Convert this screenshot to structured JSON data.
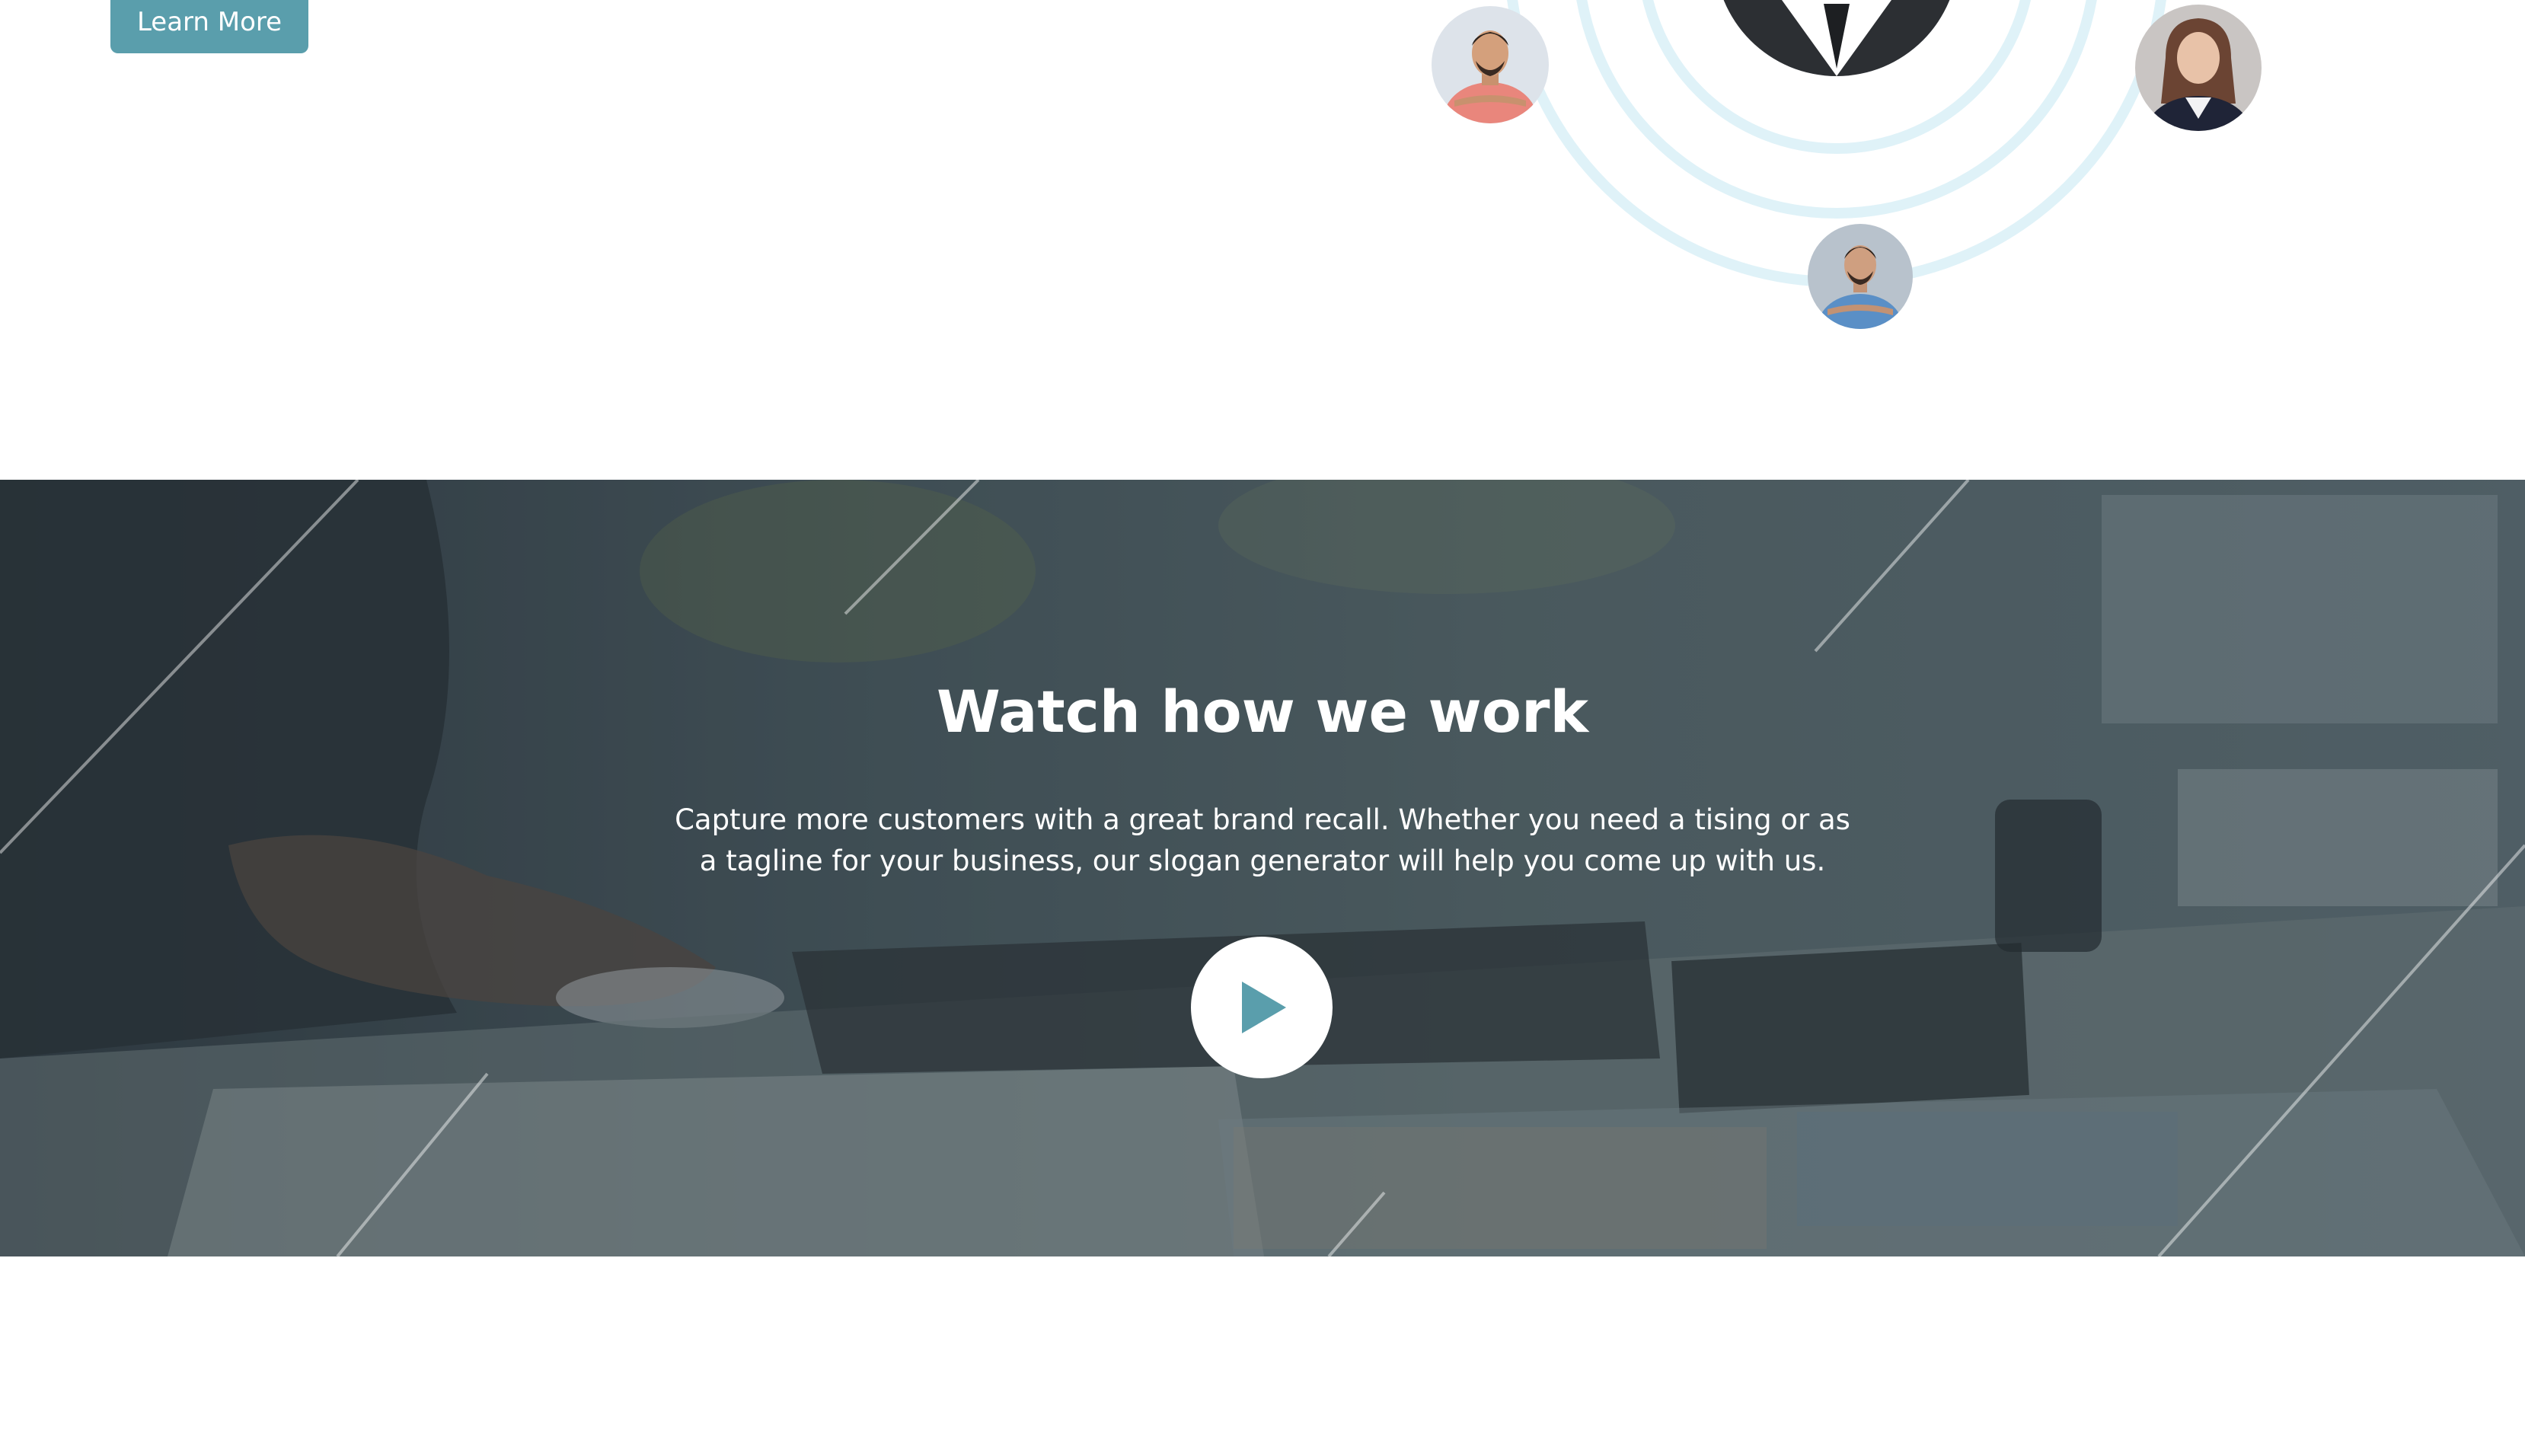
{
  "hero": {
    "cta_label": "Learn More",
    "accent_color": "#5a9eac",
    "ring_color": "#dff2f8",
    "avatars": [
      "avatar-man-pink-shirt",
      "avatar-woman-suit",
      "avatar-man-blue-shirt",
      "avatar-man-dark-suit"
    ]
  },
  "video": {
    "title": "Watch how we work",
    "description": "Capture more customers with a great brand recall. Whether you need a tising or as a tagline for your business, our slogan generator will help you come up with us.",
    "play_icon": "play-icon",
    "play_icon_color": "#5a9eac"
  }
}
